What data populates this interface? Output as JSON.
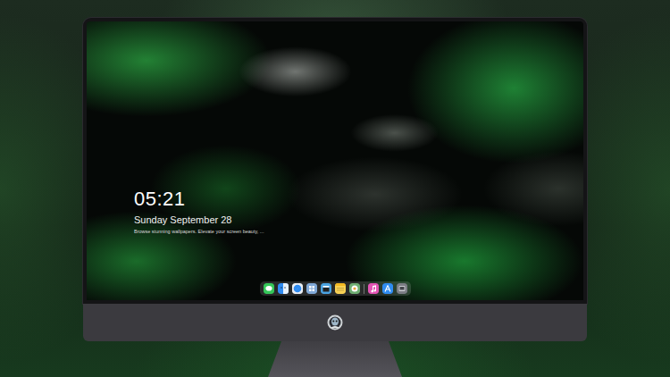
{
  "lock_screen": {
    "time": "05:21",
    "date": "Sunday September 28",
    "caption": "Browse stunning wallpapers. Elevate your screen beauty, ..."
  }
}
